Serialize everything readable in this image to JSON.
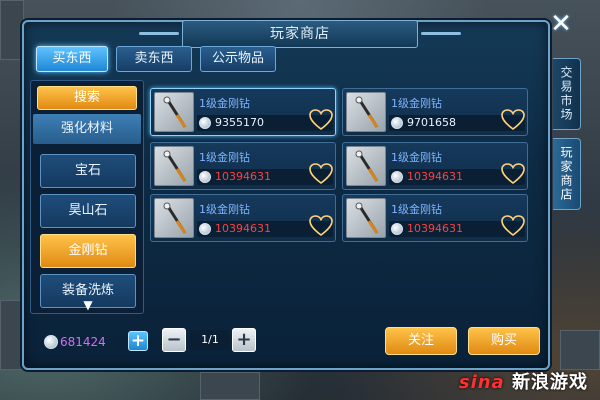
{
  "window": {
    "title": "玩家商店",
    "close_symbol": "✕"
  },
  "tabs": [
    {
      "label": "买东西",
      "active": true
    },
    {
      "label": "卖东西",
      "active": false
    },
    {
      "label": "公示物品",
      "active": false
    }
  ],
  "side_tabs": [
    {
      "label": "交易市场",
      "active": false
    },
    {
      "label": "玩家商店",
      "active": true
    }
  ],
  "sidebar": {
    "search_label": "搜索",
    "subcategory": "强化材料",
    "items": [
      {
        "label": "宝石",
        "active": false
      },
      {
        "label": "昊山石",
        "active": false
      },
      {
        "label": "金刚钻",
        "active": true
      },
      {
        "label": "装备洗炼",
        "active": false
      }
    ],
    "more_icon": "chevron-down-icon"
  },
  "listings": [
    {
      "name": "1级金刚钻",
      "price": "9355170",
      "price_color": "#e8f2ff",
      "selected": true
    },
    {
      "name": "1级金刚钻",
      "price": "9701658",
      "price_color": "#e8f2ff",
      "selected": false
    },
    {
      "name": "1级金刚钻",
      "price": "10394631",
      "price_color": "#ff4040",
      "selected": false
    },
    {
      "name": "1级金刚钻",
      "price": "10394631",
      "price_color": "#ff4040",
      "selected": false
    },
    {
      "name": "1级金刚钻",
      "price": "10394631",
      "price_color": "#ff4040",
      "selected": false
    },
    {
      "name": "1级金刚钻",
      "price": "10394631",
      "price_color": "#ff4040",
      "selected": false
    }
  ],
  "footer": {
    "balance": "681424",
    "add_symbol": "+",
    "minus_symbol": "−",
    "plus_symbol": "+",
    "page": "1/1",
    "follow_label": "关注",
    "buy_label": "购买"
  },
  "watermark": {
    "brand": "sina",
    "text": "新浪游戏"
  },
  "colors": {
    "accent_blue": "#5fc3ff",
    "accent_orange": "#e08a12",
    "price_red": "#ff4040",
    "balance_purple": "#d56cf2",
    "item_name_blue": "#7fb4ff"
  }
}
